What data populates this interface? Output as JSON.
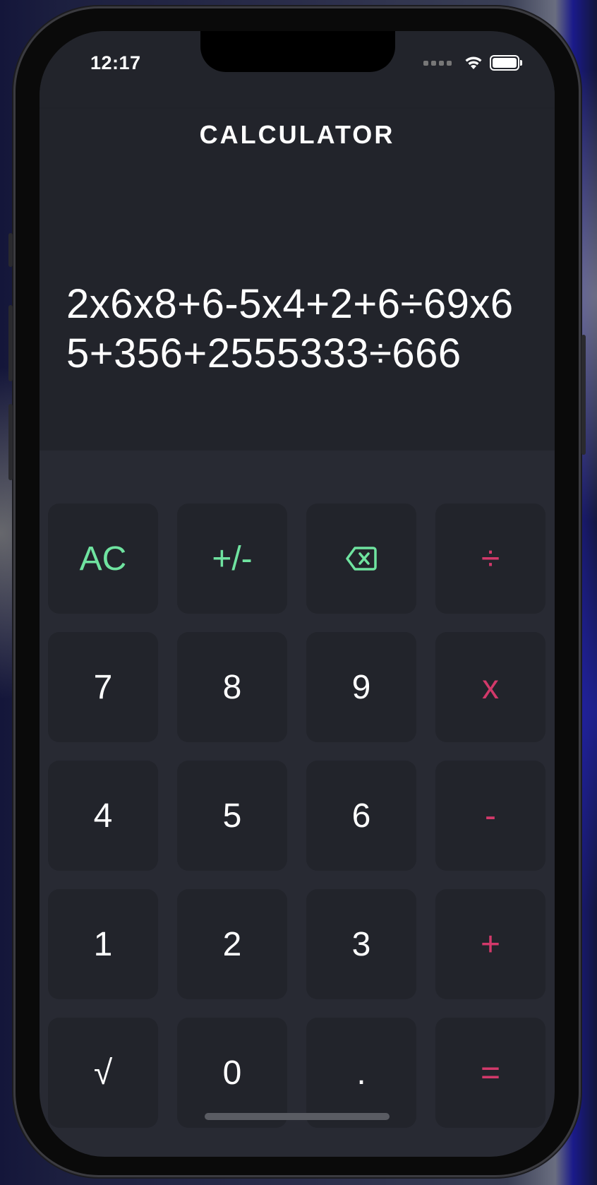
{
  "status_bar": {
    "time": "12:17"
  },
  "header": {
    "title": "CALCULATOR"
  },
  "display": {
    "expression": "2x6x8+6-5x4+2+6÷69x65+356+2555333÷666"
  },
  "keys": {
    "clear": "AC",
    "sign": "+/-",
    "backspace_icon": "backspace-icon",
    "divide": "÷",
    "seven": "7",
    "eight": "8",
    "nine": "9",
    "multiply": "x",
    "four": "4",
    "five": "5",
    "six": "6",
    "minus": "-",
    "one": "1",
    "two": "2",
    "three": "3",
    "plus": "+",
    "sqrt": "√",
    "zero": "0",
    "decimal": ".",
    "equals": "="
  },
  "colors": {
    "background": "#282a33",
    "panel": "#22242b",
    "function_key": "#6fe3a0",
    "operator_key": "#d2396a",
    "text": "#ffffff"
  }
}
